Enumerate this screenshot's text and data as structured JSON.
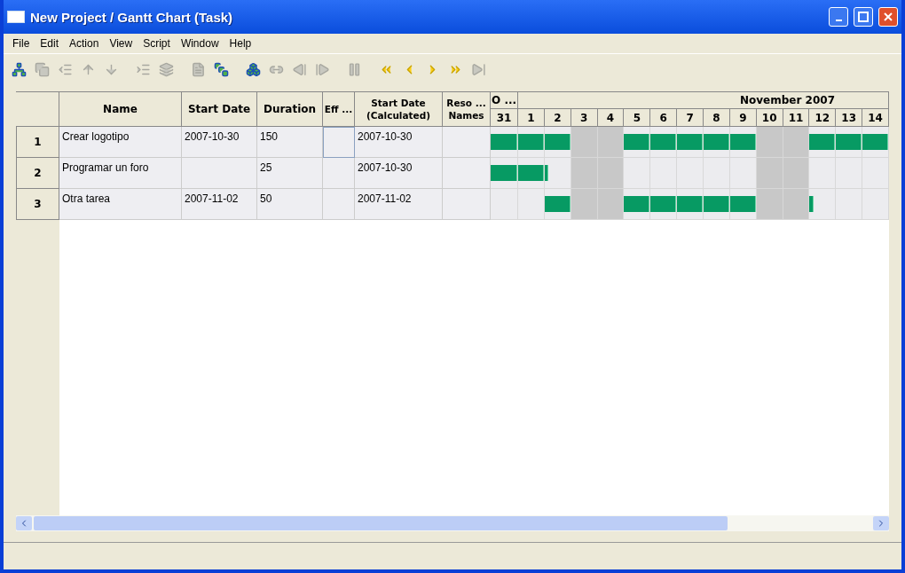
{
  "window": {
    "title": "New Project / Gantt Chart (Task)"
  },
  "menu": [
    {
      "label": "File"
    },
    {
      "label": "Edit"
    },
    {
      "label": "Action"
    },
    {
      "label": "View"
    },
    {
      "label": "Script"
    },
    {
      "label": "Window"
    },
    {
      "label": "Help"
    }
  ],
  "toolbar": [
    {
      "buttons": [
        {
          "disabled": false
        },
        {
          "disabled": true
        },
        {
          "disabled": true
        },
        {
          "disabled": true
        },
        {
          "disabled": true
        }
      ]
    },
    {
      "buttons": [
        {
          "disabled": true
        },
        {
          "disabled": true
        }
      ]
    },
    {
      "buttons": [
        {
          "disabled": true
        },
        {
          "disabled": false
        }
      ]
    },
    {
      "buttons": [
        {
          "disabled": false
        },
        {
          "disabled": true
        },
        {
          "disabled": true
        },
        {
          "disabled": true
        }
      ]
    },
    {
      "buttons": [
        {
          "disabled": true
        }
      ]
    },
    {
      "buttons": [
        {
          "disabled": false
        },
        {
          "disabled": false
        },
        {
          "disabled": false
        },
        {
          "disabled": false
        },
        {
          "disabled": true
        }
      ]
    }
  ],
  "table": {
    "columns": [
      "Name",
      "Start Date",
      "Duration",
      "Eff ...",
      "Start Date (Calculated)",
      "Reso ... Names"
    ],
    "months": [
      {
        "label": "O ...",
        "days": [
          {
            "label": "31",
            "weekend": false
          }
        ]
      },
      {
        "label": "November 2007",
        "days": [
          {
            "label": "1",
            "weekend": false
          },
          {
            "label": "2",
            "weekend": false
          },
          {
            "label": "3",
            "weekend": true
          },
          {
            "label": "4",
            "weekend": true
          },
          {
            "label": "5",
            "weekend": false
          },
          {
            "label": "6",
            "weekend": false
          },
          {
            "label": "7",
            "weekend": false
          },
          {
            "label": "8",
            "weekend": false
          },
          {
            "label": "9",
            "weekend": false
          },
          {
            "label": "10",
            "weekend": true
          },
          {
            "label": "11",
            "weekend": true
          },
          {
            "label": "12",
            "weekend": false
          },
          {
            "label": "13",
            "weekend": false
          },
          {
            "label": "14",
            "weekend": false
          }
        ]
      }
    ],
    "rows": [
      {
        "number": "1",
        "name": "Crear logotipo",
        "start_date": "2007-10-30",
        "duration": "150",
        "effort_selected": true,
        "start_calculated": "2007-10-30",
        "bars": [
          {
            "kind": "full"
          },
          {
            "kind": "full"
          },
          {
            "kind": "full"
          },
          {
            "kind": "none"
          },
          {
            "kind": "none"
          },
          {
            "kind": "full"
          },
          {
            "kind": "full"
          },
          {
            "kind": "full"
          },
          {
            "kind": "full"
          },
          {
            "kind": "full"
          },
          {
            "kind": "none"
          },
          {
            "kind": "none"
          },
          {
            "kind": "full"
          },
          {
            "kind": "full"
          },
          {
            "kind": "full"
          }
        ]
      },
      {
        "number": "2",
        "name": "Programar un foro",
        "duration": "25",
        "effort_selected": false,
        "start_calculated": "2007-10-30",
        "bars": [
          {
            "kind": "full"
          },
          {
            "kind": "full"
          },
          {
            "kind": "part"
          },
          {
            "kind": "none"
          },
          {
            "kind": "none"
          },
          {
            "kind": "none"
          },
          {
            "kind": "none"
          },
          {
            "kind": "none"
          },
          {
            "kind": "none"
          },
          {
            "kind": "none"
          },
          {
            "kind": "none"
          },
          {
            "kind": "none"
          },
          {
            "kind": "none"
          },
          {
            "kind": "none"
          },
          {
            "kind": "none"
          }
        ]
      },
      {
        "number": "3",
        "name": "Otra tarea",
        "start_date": "2007-11-02",
        "duration": "50",
        "effort_selected": false,
        "start_calculated": "2007-11-02",
        "bars": [
          {
            "kind": "none"
          },
          {
            "kind": "none"
          },
          {
            "kind": "full"
          },
          {
            "kind": "none"
          },
          {
            "kind": "none"
          },
          {
            "kind": "full"
          },
          {
            "kind": "full"
          },
          {
            "kind": "full"
          },
          {
            "kind": "full"
          },
          {
            "kind": "full"
          },
          {
            "kind": "none"
          },
          {
            "kind": "none"
          },
          {
            "kind": "part"
          },
          {
            "kind": "none"
          },
          {
            "kind": "none"
          }
        ]
      }
    ]
  }
}
